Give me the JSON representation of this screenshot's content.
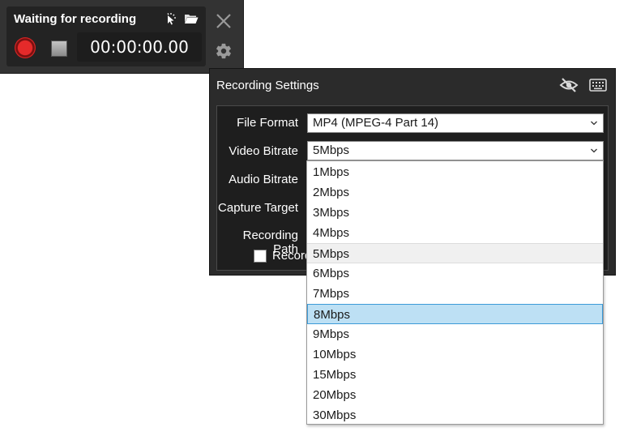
{
  "recorder": {
    "title": "Waiting for recording",
    "timer": "00:00:00.00",
    "icons": [
      "cursor-click-icon",
      "folder-open-icon",
      "record-icon",
      "stop-icon",
      "close-icon",
      "gear-icon"
    ]
  },
  "settings": {
    "title": "Recording Settings",
    "icons": [
      "eye-off-icon",
      "keyboard-icon"
    ],
    "labels": {
      "file_format": "File Format",
      "video_bitrate": "Video Bitrate",
      "audio_bitrate": "Audio Bitrate",
      "capture_target": "Capture Target",
      "recording_path": "Recording Path",
      "record_checkbox": "Record"
    },
    "file_format_value": "MP4 (MPEG-4 Part 14)",
    "video_bitrate_value": "5Mbps"
  },
  "dropdown": {
    "options": [
      "1Mbps",
      "2Mbps",
      "3Mbps",
      "4Mbps",
      "5Mbps",
      "6Mbps",
      "7Mbps",
      "8Mbps",
      "9Mbps",
      "10Mbps",
      "15Mbps",
      "20Mbps",
      "30Mbps"
    ],
    "selected": "5Mbps",
    "highlighted": "8Mbps"
  },
  "colors": {
    "panel_bg": "#2b2b2b",
    "highlight_bg": "#bde0f4",
    "highlight_border": "#3c9bd8",
    "record_red": "#e52a2a"
  }
}
